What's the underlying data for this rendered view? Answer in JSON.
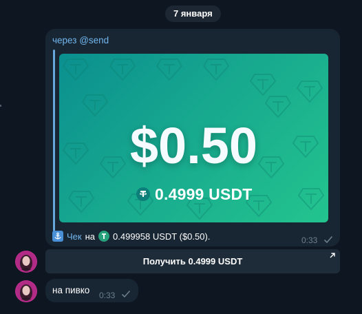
{
  "date_separator": "7 января",
  "check_message": {
    "via_bot": "через @send",
    "card": {
      "amount_usd": "$0.50",
      "amount_crypto": "0.4999 USDT"
    },
    "caption": {
      "link_text": "Чек",
      "connector": "на",
      "amount_text": "0.499958 USDT ($0.50)."
    },
    "time": "0:33",
    "status": "read"
  },
  "inline_button": {
    "label": "Получить 0.4999 USDT"
  },
  "reply_message": {
    "text": "на пивко",
    "time": "0:33",
    "status": "read"
  },
  "colors": {
    "background": "#0e1621",
    "bubble": "#182533",
    "accent_link": "#71b7ee",
    "card_gradient_start": "#0a8f8f",
    "card_gradient_end": "#23c48e",
    "tether_green": "#26a17b"
  },
  "icons": {
    "anchor": "anchor-icon",
    "tether": "tether-icon",
    "check": "check-icon",
    "external_arrow": "external-arrow-icon"
  }
}
